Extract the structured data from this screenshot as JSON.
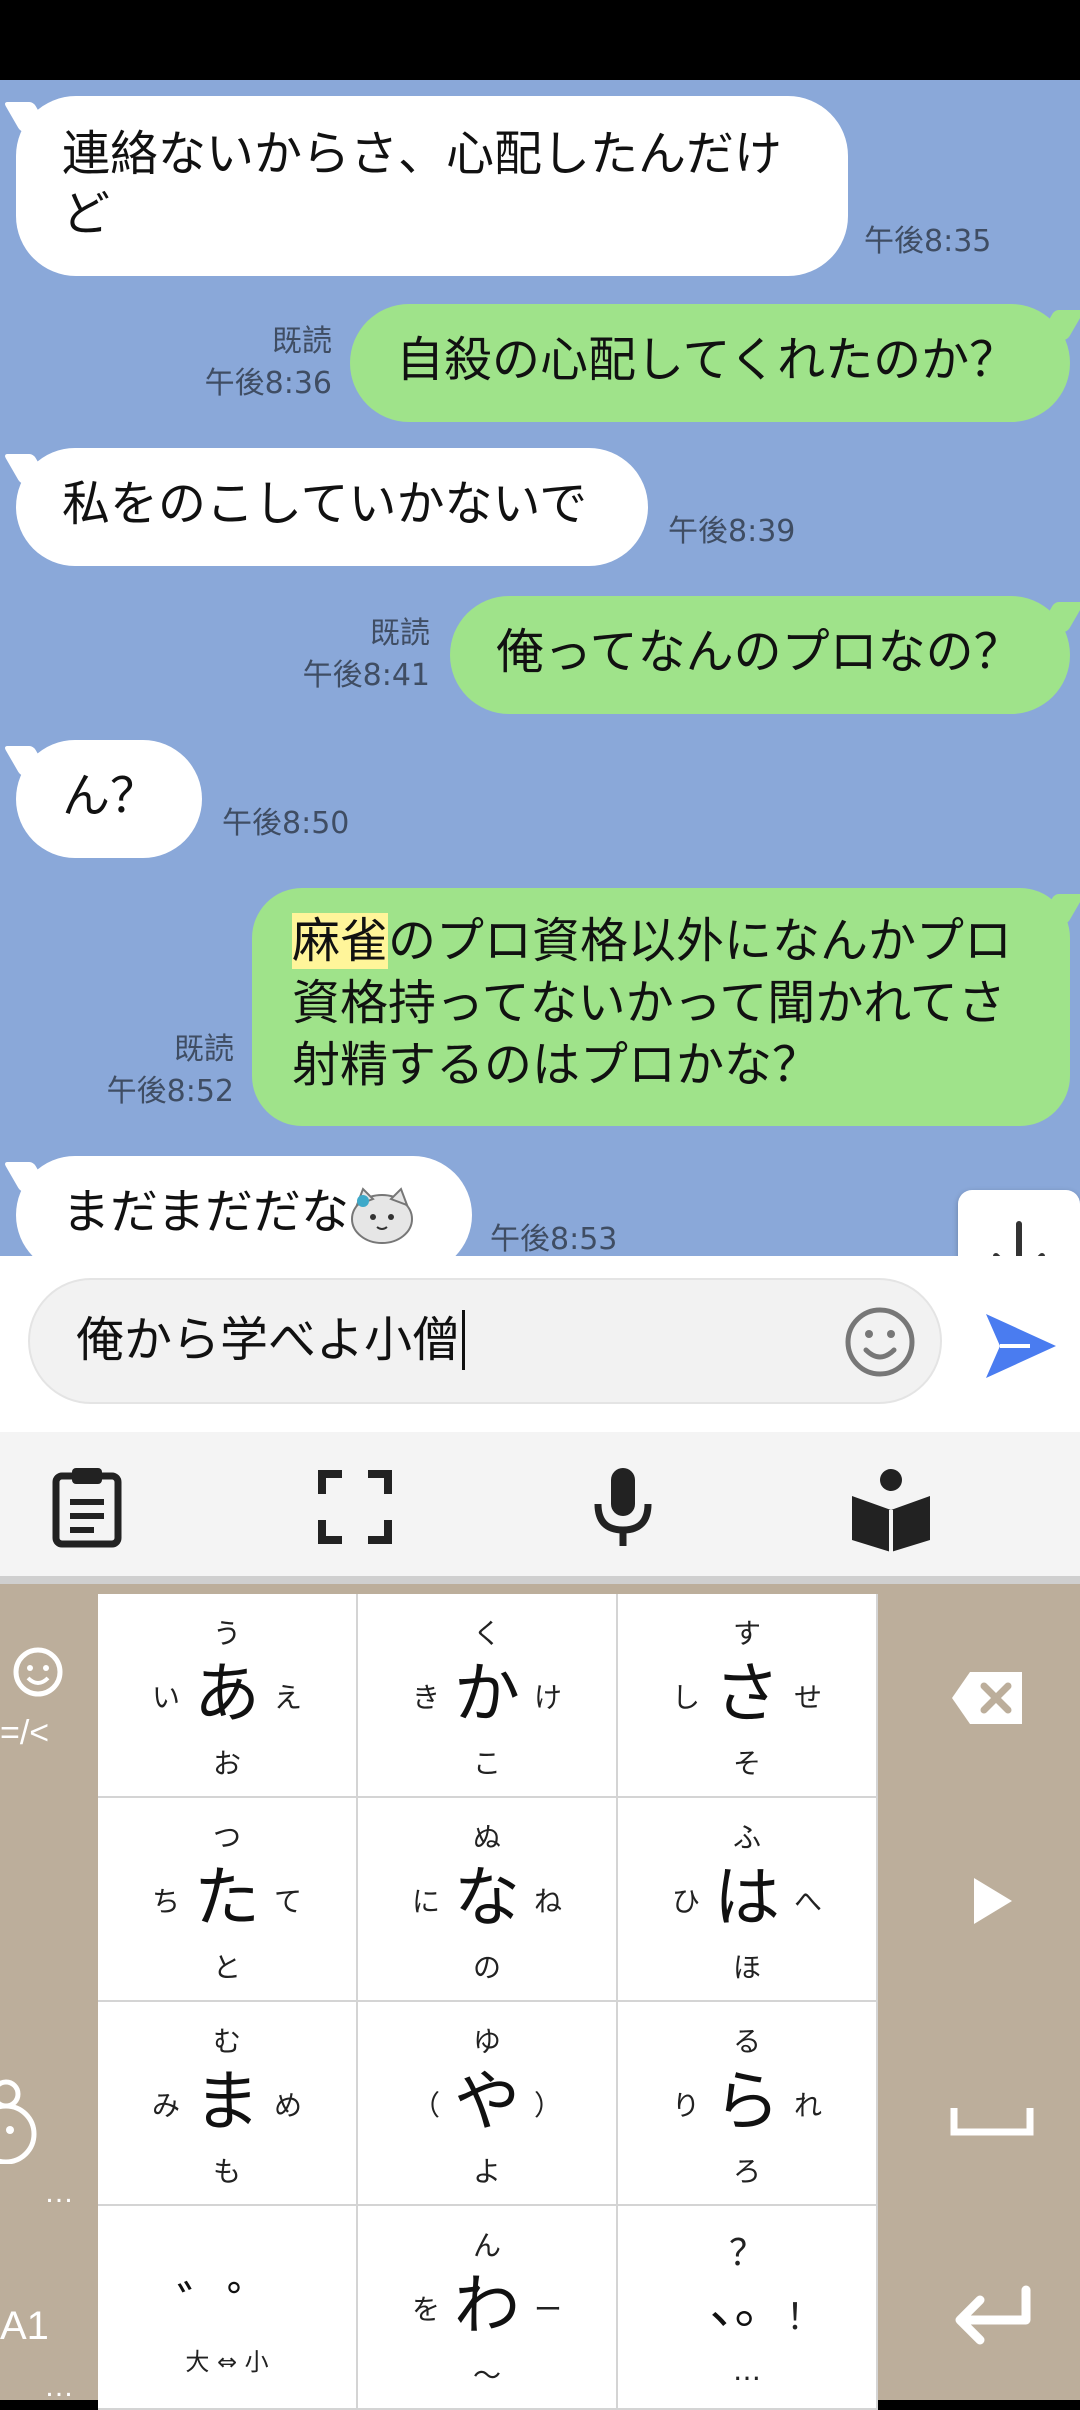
{
  "messages": [
    {
      "dir": "in",
      "text": "連絡ないからさ、心配したんだけ\nど",
      "time": "午後8:35"
    },
    {
      "dir": "out",
      "text": "自殺の心配してくれたのか？",
      "read": "既読",
      "time": "午後8:36"
    },
    {
      "dir": "in",
      "text": "私をのこしていかないで",
      "time": "午後8:39"
    },
    {
      "dir": "out",
      "text": "俺ってなんのプロなの？",
      "read": "既読",
      "time": "午後8:41"
    },
    {
      "dir": "in",
      "text": "ん？",
      "time": "午後8:50"
    },
    {
      "dir": "out",
      "highlight": "麻雀",
      "text": "のプロ資格以外になんかプロ",
      "line2": "資格持ってないかって聞かれてさ",
      "line3": "射精するのはプロかな？",
      "read": "既読",
      "time": "午後8:52"
    },
    {
      "dir": "in",
      "text": "まだまだだな",
      "sticker": "cat-emoji-icon",
      "time": "午後8:53"
    }
  ],
  "input": {
    "value": "俺から学べよ小僧"
  },
  "keyboard": {
    "keys": [
      {
        "main": "あ",
        "top": "う",
        "left": "い",
        "right": "え",
        "bottom": "お"
      },
      {
        "main": "か",
        "top": "く",
        "left": "き",
        "right": "け",
        "bottom": "こ"
      },
      {
        "main": "さ",
        "top": "す",
        "left": "し",
        "right": "せ",
        "bottom": "そ"
      },
      {
        "main": "た",
        "top": "つ",
        "left": "ち",
        "right": "て",
        "bottom": "と"
      },
      {
        "main": "な",
        "top": "ぬ",
        "left": "に",
        "right": "ね",
        "bottom": "の"
      },
      {
        "main": "は",
        "top": "ふ",
        "left": "ひ",
        "right": "へ",
        "bottom": "ほ"
      },
      {
        "main": "ま",
        "top": "む",
        "left": "み",
        "right": "め",
        "bottom": "も"
      },
      {
        "main": "や",
        "top": "ゆ",
        "left": "（",
        "right": "）",
        "bottom": "よ"
      },
      {
        "main": "ら",
        "top": "る",
        "left": "り",
        "right": "れ",
        "bottom": "ろ"
      },
      {
        "main": "゛゜",
        "top": "",
        "left": "",
        "right": "",
        "bottom": "大 ⇔ 小"
      },
      {
        "main": "わ",
        "top": "ん",
        "left": "を",
        "right": "ー",
        "bottom": "〜"
      },
      {
        "main": "、。",
        "top": "？",
        "left": "",
        "right": "！",
        "bottom": "…"
      }
    ],
    "side_left": {
      "emoticon": "=/<",
      "mode": "A1",
      "dots": "…"
    }
  },
  "colors": {
    "chat_bg": "#8aa8d9",
    "out_bubble": "#9fe38a",
    "in_bubble": "#ffffff",
    "send": "#4a7cf0",
    "keyboard_bg": "#bcae9b"
  }
}
